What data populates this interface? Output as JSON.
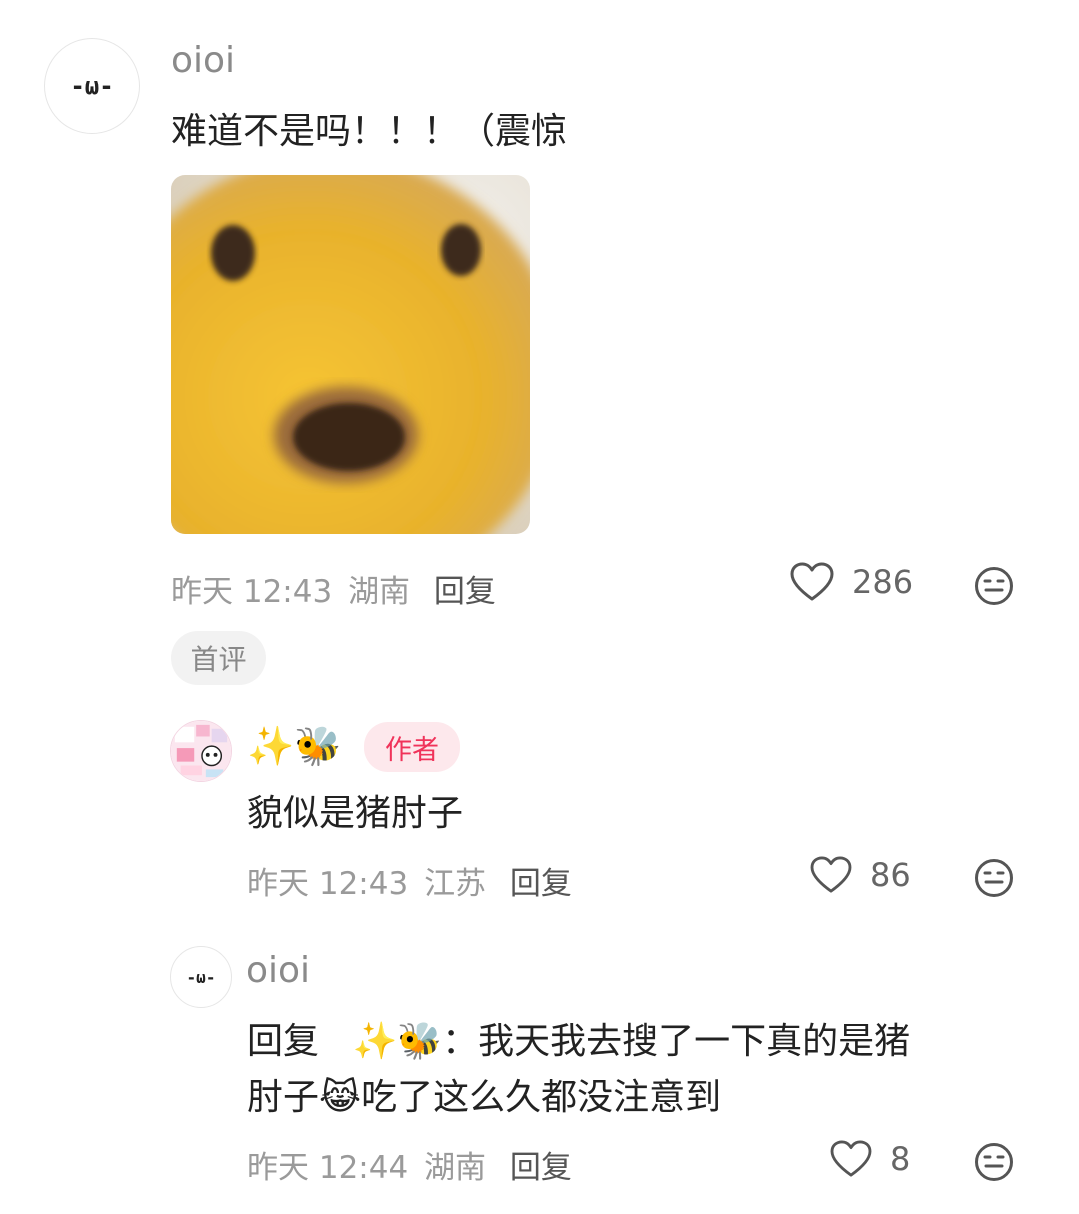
{
  "comment": {
    "avatar_text": "-ω-",
    "username": "oioi",
    "text": "难道不是吗！！！（震惊",
    "time": "昨天 12:43",
    "location": "湖南",
    "reply_label": "回复",
    "like_count": "286",
    "badge": "首评"
  },
  "replies": [
    {
      "username_emoji": "✨🐝",
      "author_badge": "作者",
      "text": "貌似是猪肘子",
      "time": "昨天 12:43",
      "location": "江苏",
      "reply_label": "回复",
      "like_count": "86"
    },
    {
      "avatar_text": "-ω-",
      "username": "oioi",
      "reply_prefix": "回复",
      "reply_to": "✨🐝",
      "text_line1": "我天我去搜了一下真的是猪",
      "text_line2a": "肘子",
      "text_emoji": "😹",
      "text_line2b": "吃了这么久都没注意到",
      "time": "昨天 12:44",
      "location": "湖南",
      "reply_label": "回复",
      "like_count": "8"
    }
  ],
  "colors": {
    "author_badge_bg": "#fde8ec",
    "author_badge_text": "#f0335a",
    "meta_text": "#9a9a9a"
  },
  "icons": {
    "like": "heart-outline-icon",
    "dislike": "meh-face-icon"
  }
}
